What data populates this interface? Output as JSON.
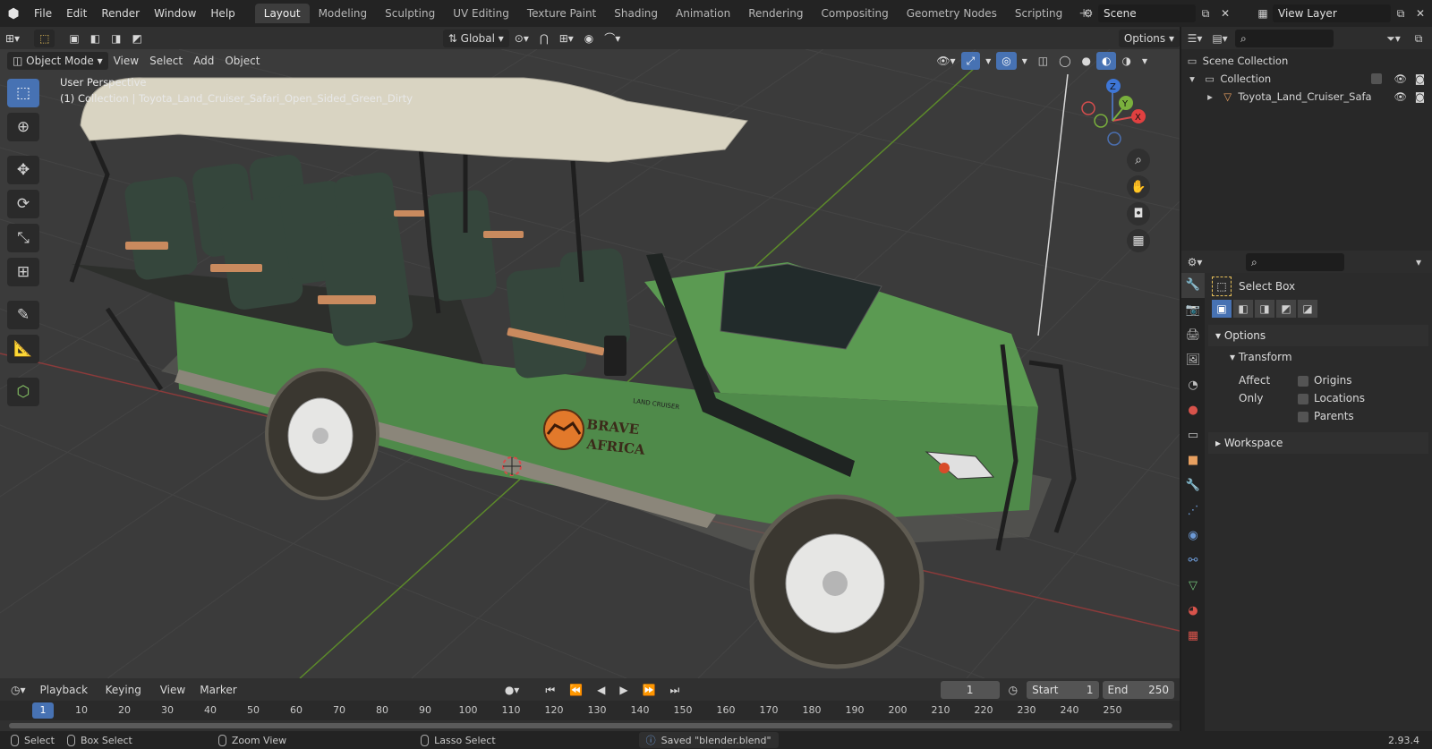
{
  "menu": [
    "File",
    "Edit",
    "Render",
    "Window",
    "Help"
  ],
  "workspaces": [
    "Layout",
    "Modeling",
    "Sculpting",
    "UV Editing",
    "Texture Paint",
    "Shading",
    "Animation",
    "Rendering",
    "Compositing",
    "Geometry Nodes",
    "Scripting"
  ],
  "active_workspace": "Layout",
  "scene": {
    "name": "Scene",
    "view_layer": "View Layer"
  },
  "viewport_header": {
    "transform_orientation": "Global",
    "options_label": "Options",
    "mode": "Object Mode",
    "menus": [
      "View",
      "Select",
      "Add",
      "Object"
    ]
  },
  "viewport": {
    "perspective_label": "User Perspective",
    "collection_label": "(1) Collection | Toyota_Land_Cruiser_Safari_Open_Sided_Green_Dirty",
    "logo_text_line1": "BRAVE",
    "logo_text_line2": "AFRICA",
    "badge_text": "LAND CRUISER",
    "axis_labels": {
      "z": "Z",
      "y": "Y",
      "x": "X"
    }
  },
  "outliner": {
    "rows": [
      {
        "label": "Scene Collection"
      },
      {
        "label": "Collection"
      },
      {
        "label": "Toyota_Land_Cruiser_Safa"
      }
    ]
  },
  "properties": {
    "tool_name": "Select Box",
    "options_panel": "Options",
    "transform_panel": "Transform",
    "affect_only_label": "Affect Only",
    "checkboxes": [
      "Origins",
      "Locations",
      "Parents"
    ],
    "workspace_panel": "Workspace"
  },
  "timeline": {
    "menus": [
      "Playback",
      "Keying",
      "View",
      "Marker"
    ],
    "current_frame": "1",
    "start_label": "Start",
    "start_value": "1",
    "end_label": "End",
    "end_value": "250",
    "ticks": [
      "1",
      "10",
      "20",
      "30",
      "40",
      "50",
      "60",
      "70",
      "80",
      "90",
      "100",
      "110",
      "120",
      "130",
      "140",
      "150",
      "160",
      "170",
      "180",
      "190",
      "200",
      "210",
      "220",
      "230",
      "240",
      "250"
    ]
  },
  "status": {
    "select": "Select",
    "box_select": "Box Select",
    "zoom_view": "Zoom View",
    "lasso_select": "Lasso Select",
    "message": "Saved \"blender.blend\"",
    "version": "2.93.4"
  },
  "colors": {
    "accent": "#4772b3",
    "vehicle_green": "#4f8a4a",
    "canopy": "#d9d4c2"
  }
}
